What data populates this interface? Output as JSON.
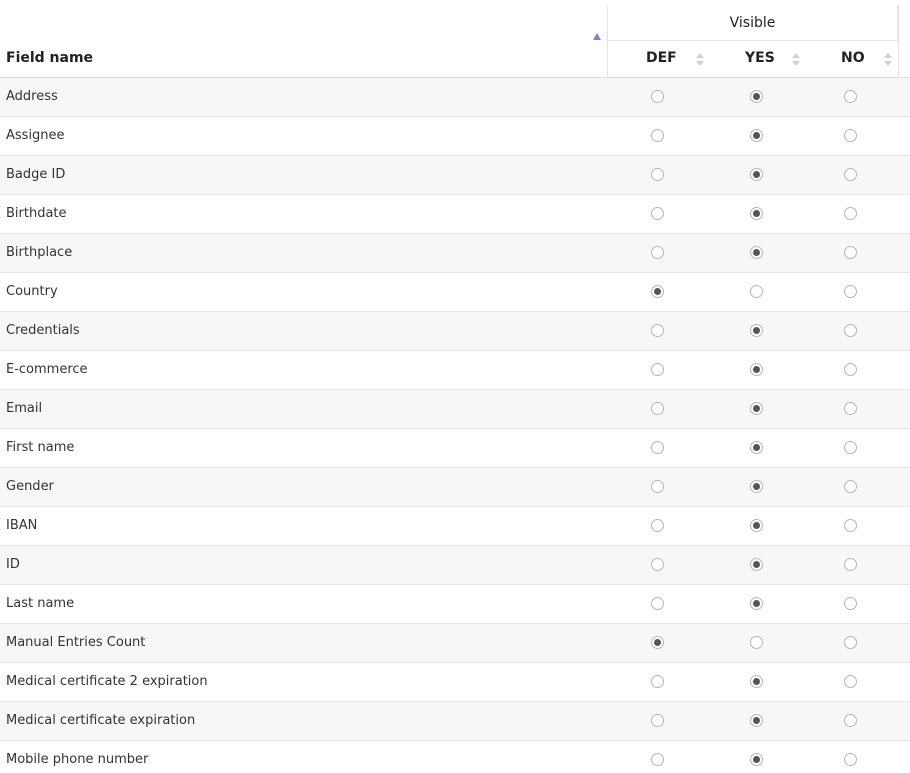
{
  "header": {
    "group_label": "Visible",
    "field_name_label": "Field name",
    "columns": [
      "DEF",
      "YES",
      "NO"
    ]
  },
  "rows": [
    {
      "name": "Address",
      "selected": "YES"
    },
    {
      "name": "Assignee",
      "selected": "YES"
    },
    {
      "name": "Badge ID",
      "selected": "YES"
    },
    {
      "name": "Birthdate",
      "selected": "YES"
    },
    {
      "name": "Birthplace",
      "selected": "YES"
    },
    {
      "name": "Country",
      "selected": "DEF"
    },
    {
      "name": "Credentials",
      "selected": "YES"
    },
    {
      "name": "E-commerce",
      "selected": "YES"
    },
    {
      "name": "Email",
      "selected": "YES"
    },
    {
      "name": "First name",
      "selected": "YES"
    },
    {
      "name": "Gender",
      "selected": "YES"
    },
    {
      "name": "IBAN",
      "selected": "YES"
    },
    {
      "name": "ID",
      "selected": "YES"
    },
    {
      "name": "Last name",
      "selected": "YES"
    },
    {
      "name": "Manual Entries Count",
      "selected": "DEF"
    },
    {
      "name": "Medical certificate 2 expiration",
      "selected": "YES"
    },
    {
      "name": "Medical certificate expiration",
      "selected": "YES"
    },
    {
      "name": "Mobile phone number",
      "selected": "YES"
    }
  ],
  "colors": {
    "sort_active": "#7b83d8",
    "row_alt": "#f7f7f7",
    "radio_dot": "#555555"
  }
}
